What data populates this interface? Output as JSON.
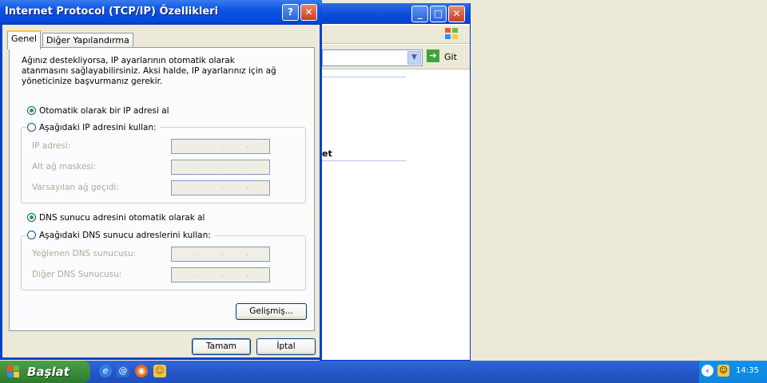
{
  "dialog": {
    "title": "Internet Protocol (TCP/IP) Özellikleri",
    "help_button": "?",
    "close_button": "✕",
    "tabs": [
      {
        "label": "Genel",
        "active": true
      },
      {
        "label": "Diğer Yapılandırma",
        "active": false
      }
    ],
    "intro_text": "Ağınız destekliyorsa, IP ayarlarının otomatik olarak atanmasını sağlayabilirsiniz. Aksi halde, IP ayarlarınız için ağ yöneticinize başvurmanız gerekir.",
    "ip_auto_option": "Otomatik olarak bir IP adresi al",
    "ip_manual_option": "Aşağıdaki IP adresini kullan:",
    "ip_selected": "auto",
    "ip_fields": [
      {
        "label": "IP adresi:",
        "value": ".  .  ."
      },
      {
        "label": "Alt ağ maskesi:",
        "value": ".  .  ."
      },
      {
        "label": "Varsayılan ağ geçidi:",
        "value": ".  .  ."
      }
    ],
    "dns_auto_option": "DNS sunucu adresini otomatik olarak al",
    "dns_manual_option": "Aşağıdaki DNS sunucu adreslerini kullan:",
    "dns_selected": "auto",
    "dns_fields": [
      {
        "label": "Yeğlenen DNS sunucusu:",
        "value": ".  .  ."
      },
      {
        "label": "Diğer DNS Sunucusu:",
        "value": ".  .  ."
      }
    ],
    "advanced_button": "Gelişmiş...",
    "ok_button": "Tamam",
    "cancel_button": "İptal"
  },
  "background_window": {
    "go_label": "Git",
    "partial_text": "et"
  },
  "taskbar": {
    "start_label": "Başlat",
    "clock": "14:35",
    "quick_launch": [
      "internet-explorer-icon",
      "outlook-express-icon",
      "firefox-icon",
      "messenger-icon"
    ]
  },
  "colors": {
    "titlebar": "#0A54E3",
    "start_green": "#3C8C3B",
    "tab_highlight": "#FFC83C",
    "dialog_bg": "#ECE9D8"
  }
}
